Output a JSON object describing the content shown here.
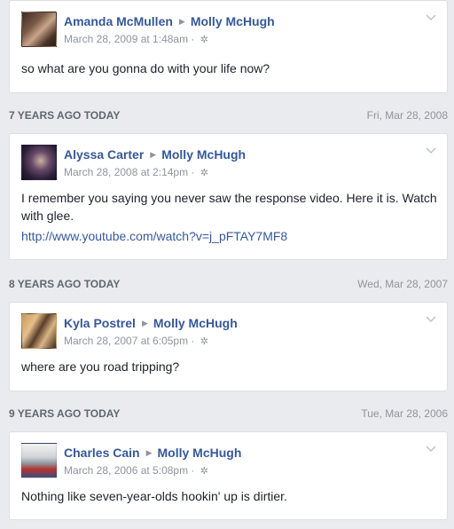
{
  "posts": [
    {
      "author": "Amanda McMullen",
      "target": "Molly McHugh",
      "timestamp": "March 28, 2009 at 1:48am",
      "text": "so what are you gonna do with your life now?",
      "link": ""
    },
    {
      "author": "Alyssa Carter",
      "target": "Molly McHugh",
      "timestamp": "March 28, 2008 at 2:14pm",
      "text": "I remember you saying you never saw the response video. Here it is. Watch with glee.",
      "link": "http://www.youtube.com/watch?v=j_pFTAY7MF8"
    },
    {
      "author": "Kyla Postrel",
      "target": "Molly McHugh",
      "timestamp": "March 28, 2007 at 6:05pm",
      "text": "where are you road tripping?",
      "link": ""
    },
    {
      "author": "Charles Cain",
      "target": "Molly McHugh",
      "timestamp": "March 28, 2006 at 5:08pm",
      "text": "Nothing like seven-year-olds hookin' up is dirtier.",
      "link": ""
    }
  ],
  "sections": [
    {
      "label": "7 YEARS AGO TODAY",
      "date": "Fri, Mar 28, 2008"
    },
    {
      "label": "8 YEARS AGO TODAY",
      "date": "Wed, Mar 28, 2007"
    },
    {
      "label": "9 YEARS AGO TODAY",
      "date": "Tue, Mar 28, 2006"
    }
  ],
  "icons": {
    "privacy": "gear-icon",
    "separator": "triangle-right-icon",
    "options": "chevron-down-icon"
  },
  "colors": {
    "link": "#365899",
    "background": "#e9ebee"
  }
}
